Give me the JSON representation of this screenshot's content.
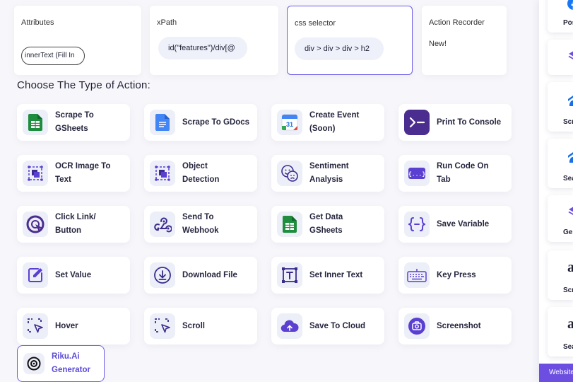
{
  "fields": {
    "attributes": {
      "label": "Attributes",
      "value": "innerText (Fill In"
    },
    "xpath": {
      "label": "xPath",
      "value": "id(\"features\")/div[@"
    },
    "css": {
      "label": "css selector",
      "value": "div > div > div > h2"
    },
    "recorder": {
      "label": "Action Recorder",
      "badge": "New!"
    }
  },
  "heading": "Choose The Type of Action:",
  "actions": [
    {
      "label": "Scrape To\nGSheets",
      "icon": "google-sheets-icon"
    },
    {
      "label": "Scrape To GDocs",
      "icon": "google-docs-icon"
    },
    {
      "label": "Create Event\n(Soon)",
      "icon": "google-calendar-icon"
    },
    {
      "label": "Print To Console",
      "icon": "terminal-icon"
    },
    {
      "label": "OCR Image To\nText",
      "icon": "ocr-icon"
    },
    {
      "label": "Object\nDetection",
      "icon": "object-detection-icon"
    },
    {
      "label": "Sentiment\nAnalysis",
      "icon": "sentiment-face-icon"
    },
    {
      "label": "Run Code On\nTab",
      "icon": "code-icon"
    },
    {
      "label": "Click Link/\nButton",
      "icon": "cursor-click-icon"
    },
    {
      "label": "Send To\nWebhook",
      "icon": "webhook-icon"
    },
    {
      "label": "Get Data\nGSheets",
      "icon": "google-sheets-icon"
    },
    {
      "label": "Save Variable",
      "icon": "curly-braces-icon"
    },
    {
      "label": "Set Value",
      "icon": "edit-icon"
    },
    {
      "label": "Download File",
      "icon": "download-icon"
    },
    {
      "label": "Set Inner Text",
      "icon": "text-box-icon"
    },
    {
      "label": "Key Press",
      "icon": "keyboard-icon"
    },
    {
      "label": "Hover",
      "icon": "hover-cursor-icon"
    },
    {
      "label": "Scroll",
      "icon": "scroll-cursor-icon"
    },
    {
      "label": "Save To Cloud",
      "icon": "cloud-icon"
    },
    {
      "label": "Screenshot",
      "icon": "camera-icon"
    },
    {
      "label": "Riku.Ai\nGenerator",
      "icon": "riku-logo-icon"
    }
  ],
  "side_panel": {
    "cards": [
      {
        "label": "Post",
        "icon": "facebook-icon"
      },
      {
        "label": "",
        "icon": "layers-icon"
      },
      {
        "label": "Scra",
        "icon": "zillow-icon"
      },
      {
        "label": "Sear",
        "icon": "zillow-icon"
      },
      {
        "label": "Gene",
        "icon": "layers-icon"
      },
      {
        "label": "Scra",
        "icon": "amazon-icon"
      },
      {
        "label": "Sear",
        "icon": "amazon-icon"
      }
    ],
    "footer": "Website"
  },
  "colors": {
    "accent": "#6c5ce7",
    "sheets": "#1e8e3e",
    "docs": "#4285f4",
    "terminal": "#4b2d8f",
    "purple": "#5b3fd1"
  }
}
